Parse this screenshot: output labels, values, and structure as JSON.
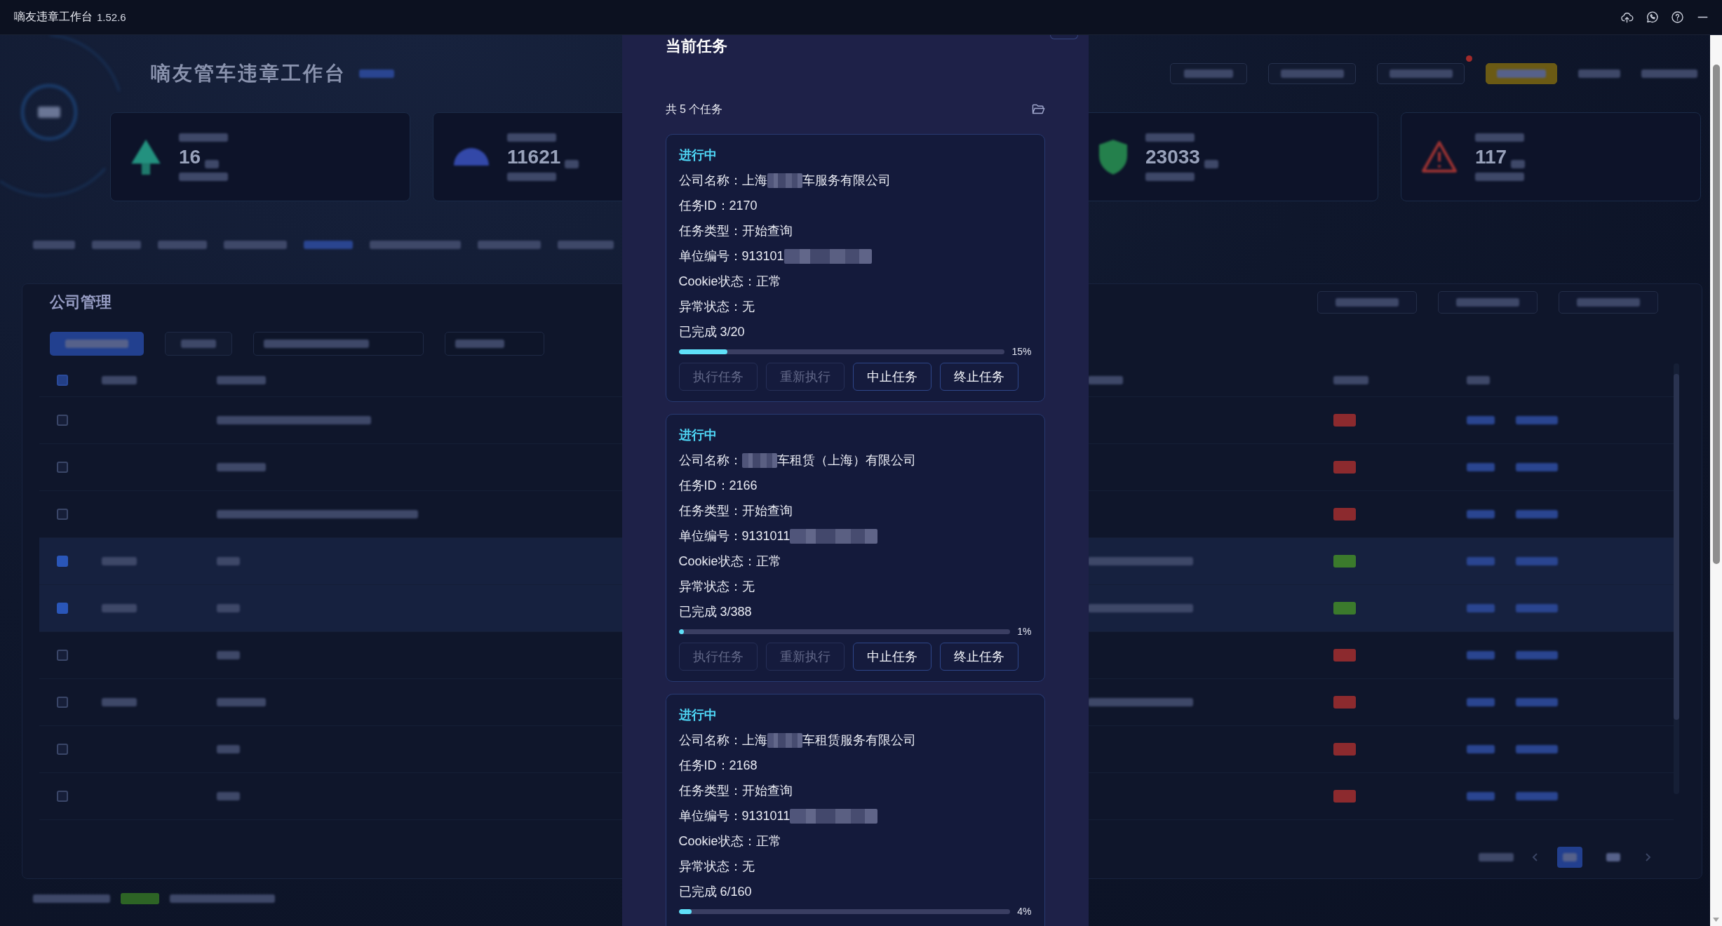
{
  "window": {
    "title": "嘀友违章工作台",
    "version": "1.52.6"
  },
  "dashboard": {
    "title": "嘀友管车违章工作台",
    "stats": [
      {
        "value": "16"
      },
      {
        "value": "11621"
      },
      {
        "value": "23033"
      },
      {
        "value": "117"
      }
    ],
    "section_title": "公司管理",
    "header_checkbox": {
      "indeterminate": true
    },
    "rows": [
      {
        "checked": false,
        "color": "#8c2a2e"
      },
      {
        "checked": false,
        "color": "#8c2a2e"
      },
      {
        "checked": false,
        "color": "#8c2a2e"
      },
      {
        "checked": true,
        "color": "#3b7a2c"
      },
      {
        "checked": true,
        "color": "#3b7a2c"
      },
      {
        "checked": false,
        "color": "#8c2a2e"
      },
      {
        "checked": false,
        "color": "#8c2a2e"
      },
      {
        "checked": false,
        "color": "#8c2a2e"
      },
      {
        "checked": false,
        "color": "#8c2a2e"
      }
    ],
    "pages": [
      {
        "selected": true
      },
      {
        "selected": false
      }
    ]
  },
  "task_panel": {
    "title": "当前任务",
    "count": "共 5 个任务",
    "tasks": [
      {
        "status": "进行中",
        "fields": [
          {
            "kind": "redacted",
            "before": "公司名称：上海",
            "after": "车服务有限公司"
          },
          {
            "kind": "text",
            "text": "任务ID：2170"
          },
          {
            "kind": "text",
            "text": "任务类型：开始查询"
          },
          {
            "kind": "redacted",
            "before": "单位编号：913101"
          },
          {
            "kind": "text",
            "text": "Cookie状态：正常"
          },
          {
            "kind": "text",
            "text": "异常状态：无"
          }
        ],
        "progress": {
          "label": "已完成 3/20",
          "level": 0.15,
          "percent": "15%"
        },
        "buttons": [
          {
            "label": "执行任务",
            "disabled": true
          },
          {
            "label": "重新执行",
            "disabled": true
          },
          {
            "label": "中止任务",
            "disabled": false
          },
          {
            "label": "终止任务",
            "disabled": false
          }
        ]
      },
      {
        "status": "进行中",
        "fields": [
          {
            "kind": "redacted",
            "before": "公司名称：",
            "after": "车租赁（上海）有限公司"
          },
          {
            "kind": "text",
            "text": "任务ID：2166"
          },
          {
            "kind": "text",
            "text": "任务类型：开始查询"
          },
          {
            "kind": "redacted",
            "before": "单位编号：9131011"
          },
          {
            "kind": "text",
            "text": "Cookie状态：正常"
          },
          {
            "kind": "text",
            "text": "异常状态：无"
          }
        ],
        "progress": {
          "label": "已完成 3/388",
          "level": 0.01,
          "percent": "1%"
        },
        "buttons": [
          {
            "label": "执行任务",
            "disabled": true
          },
          {
            "label": "重新执行",
            "disabled": true
          },
          {
            "label": "中止任务",
            "disabled": false
          },
          {
            "label": "终止任务",
            "disabled": false
          }
        ]
      },
      {
        "status": "进行中",
        "fields": [
          {
            "kind": "redacted",
            "before": "公司名称：上海",
            "after": "车租赁服务有限公司"
          },
          {
            "kind": "text",
            "text": "任务ID：2168"
          },
          {
            "kind": "text",
            "text": "任务类型：开始查询"
          },
          {
            "kind": "redacted",
            "before": "单位编号：9131011"
          },
          {
            "kind": "text",
            "text": "Cookie状态：正常"
          },
          {
            "kind": "text",
            "text": "异常状态：无"
          }
        ],
        "progress": {
          "label": "已完成 6/160",
          "level": 0.04,
          "percent": "4%"
        }
      }
    ]
  }
}
